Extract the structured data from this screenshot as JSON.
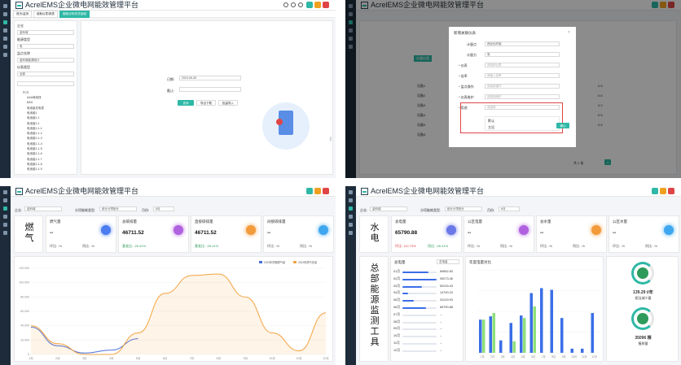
{
  "app": {
    "title": "AcrelEMS企业微电网能效管理平台"
  },
  "q1": {
    "tabs": [
      "首页/监测",
      "能耗仪表/报表",
      "能耗分析/历史曲线"
    ],
    "filters": [
      {
        "label": "企业",
        "value": "金科城"
      },
      {
        "label": "能源类型",
        "value": "电"
      },
      {
        "label": "监点名称",
        "value": "金科城能源统计"
      },
      {
        "label": "仪表类型",
        "value": "全部"
      }
    ],
    "tree_root": "PCS",
    "tree_items": [
      "AAA母线排",
      "BAG",
      "电池组总电表",
      "电池组1",
      "电池组1-1",
      "电池组1-1",
      "电池组1-1-1",
      "电池组1-1-2",
      "电池组1-1-3",
      "电池组1-1-4",
      "电池组1-1-5",
      "电池组1-1-6",
      "电池组1-1-7",
      "电池组1-1-8",
      "电池组1-1-9"
    ],
    "date_label": "日期:",
    "date_value": "2023-06-28",
    "range_label": "截止:",
    "buttons": {
      "query": "查询",
      "report": "导出下载",
      "print": "批量导入"
    }
  },
  "q2": {
    "dialog_title": "新增关联仪表",
    "fields": [
      {
        "label": "计量点",
        "value": "西北化纤能"
      },
      {
        "label": "计量方",
        "value": "电"
      },
      {
        "label": "* 仪表",
        "value": "请选择仪表"
      },
      {
        "label": "* 倍率",
        "value": "请输入倍率"
      },
      {
        "label": "* 监点操作",
        "value": "请选择操作"
      },
      {
        "label": "* 仪表维护",
        "value": "请选择维护"
      },
      {
        "label": "* 用途",
        "value": "请选择"
      }
    ],
    "dropdown_options": [
      "默认",
      "主设"
    ],
    "confirm": "确认",
    "bg_labels": [
      "设备1",
      "设备2",
      "设备3",
      "设备4",
      "设备5",
      "设备6"
    ],
    "bg_values": [
      "0.5",
      "0.5",
      "0.2",
      "0.5",
      "0.5"
    ],
    "bg_tag": "计量仪表",
    "pager": "共 2 条",
    "page_num": "1"
  },
  "q3": {
    "company_label": "企业:",
    "company": "金科城",
    "group_label": "分项能耗类型:",
    "group": "统计分项统计",
    "month_label": "月份:",
    "month": "6月",
    "title": "燃气",
    "cards": [
      {
        "name": "燃气量",
        "value": "--",
        "sub1": "环比: -%",
        "sub2": "同比: -%",
        "color": "#4c7cf0"
      },
      {
        "name": "总碳排量",
        "value": "46711.52",
        "sub1": "基准比: -26.41%",
        "color": "#b061e0"
      },
      {
        "name": "直接碳排量",
        "value": "46711.52",
        "sub1": "基准比: -26.41%",
        "color": "#f39a3a"
      },
      {
        "name": "间接碳排量",
        "value": "--",
        "sub1": "环比: -%",
        "sub2": "同比: -%",
        "color": "#3fa7f0"
      }
    ],
    "legend": [
      "2023年同期燃气量",
      "2022年燃气总量"
    ],
    "chart_data": {
      "type": "line",
      "x": [
        "1月",
        "2月",
        "3月",
        "4月",
        "5月",
        "6月",
        "7月",
        "8月",
        "9月",
        "10月",
        "11月",
        "12月"
      ],
      "ylim": [
        0,
        120000
      ],
      "yticks": [
        0,
        20000,
        40000,
        60000,
        80000,
        100000,
        120000
      ],
      "series": [
        {
          "name": "2023年同期燃气量",
          "color": "#4a6fd8",
          "values": [
            38000,
            12000,
            2000,
            6000,
            22000,
            null,
            null,
            null,
            null,
            null,
            null,
            null
          ]
        },
        {
          "name": "2022年燃气总量",
          "color": "#f3a340",
          "values": [
            40000,
            15000,
            0,
            0,
            30000,
            85000,
            110000,
            112000,
            80000,
            30000,
            5000,
            58000
          ]
        }
      ]
    }
  },
  "q4": {
    "company_label": "企业:",
    "company": "金科城",
    "group_label": "分项能耗类型:",
    "group": "统计分项统计",
    "month_label": "月份:",
    "month": "6月",
    "title": "水电",
    "side_title": "总部能源监测工具",
    "cards": [
      {
        "name": "总电量",
        "value": "65790.88",
        "sub1": "环比: 110.73%",
        "sub2": "同比: -26.41%",
        "color": "#6b78e8"
      },
      {
        "name": "公区电量",
        "value": "--",
        "sub1": "环比: -%",
        "sub2": "同比: -%",
        "color": "#b061e0"
      },
      {
        "name": "总水量",
        "value": "--",
        "sub1": "环比: -%",
        "sub2": "同比: -%",
        "color": "#f39a3a"
      },
      {
        "name": "公区水量",
        "value": "--",
        "sub1": "环比: -%",
        "sub2": "同比: -%",
        "color": "#3fa7f0"
      }
    ],
    "list_title": "总电量",
    "list_select": "总电量",
    "list": [
      {
        "m": "01月",
        "v": "69852.83",
        "f": 0.75
      },
      {
        "m": "02月",
        "v": "93273.46",
        "f": 1.0
      },
      {
        "m": "03月",
        "v": "52015.43",
        "f": 0.56
      },
      {
        "m": "04月",
        "v": "14700.23",
        "f": 0.16
      },
      {
        "m": "05月",
        "v": "31219.93",
        "f": 0.33
      },
      {
        "m": "06月",
        "v": "65790.88",
        "f": 0.7
      },
      {
        "m": "07月",
        "v": "--",
        "f": 0
      },
      {
        "m": "08月",
        "v": "--",
        "f": 0
      },
      {
        "m": "09月",
        "v": "--",
        "f": 0
      },
      {
        "m": "10月",
        "v": "--",
        "f": 0
      },
      {
        "m": "11月",
        "v": "--",
        "f": 0
      },
      {
        "m": "12月",
        "v": "--",
        "f": 0
      }
    ],
    "bar_title": "年度电量对比",
    "chart_data": {
      "type": "bar",
      "categories": [
        "1月",
        "2月",
        "3月",
        "4月",
        "5月",
        "6月",
        "7月",
        "8月",
        "9月",
        "10月",
        "11月",
        "12月"
      ],
      "ylim": [
        0,
        100
      ],
      "series": [
        {
          "color": "#3a6ee8",
          "values": [
            40,
            44,
            15,
            36,
            45,
            72,
            78,
            76,
            42,
            5,
            5,
            48
          ]
        },
        {
          "color": "#8ee07a",
          "values": [
            40,
            48,
            0,
            14,
            42,
            56,
            0,
            0,
            0,
            0,
            0,
            0
          ]
        }
      ]
    },
    "eco1_value": "139.29 t/年",
    "eco1_label": "相当减少量",
    "eco2_value": "35096 棵",
    "eco2_label": "植树量"
  }
}
